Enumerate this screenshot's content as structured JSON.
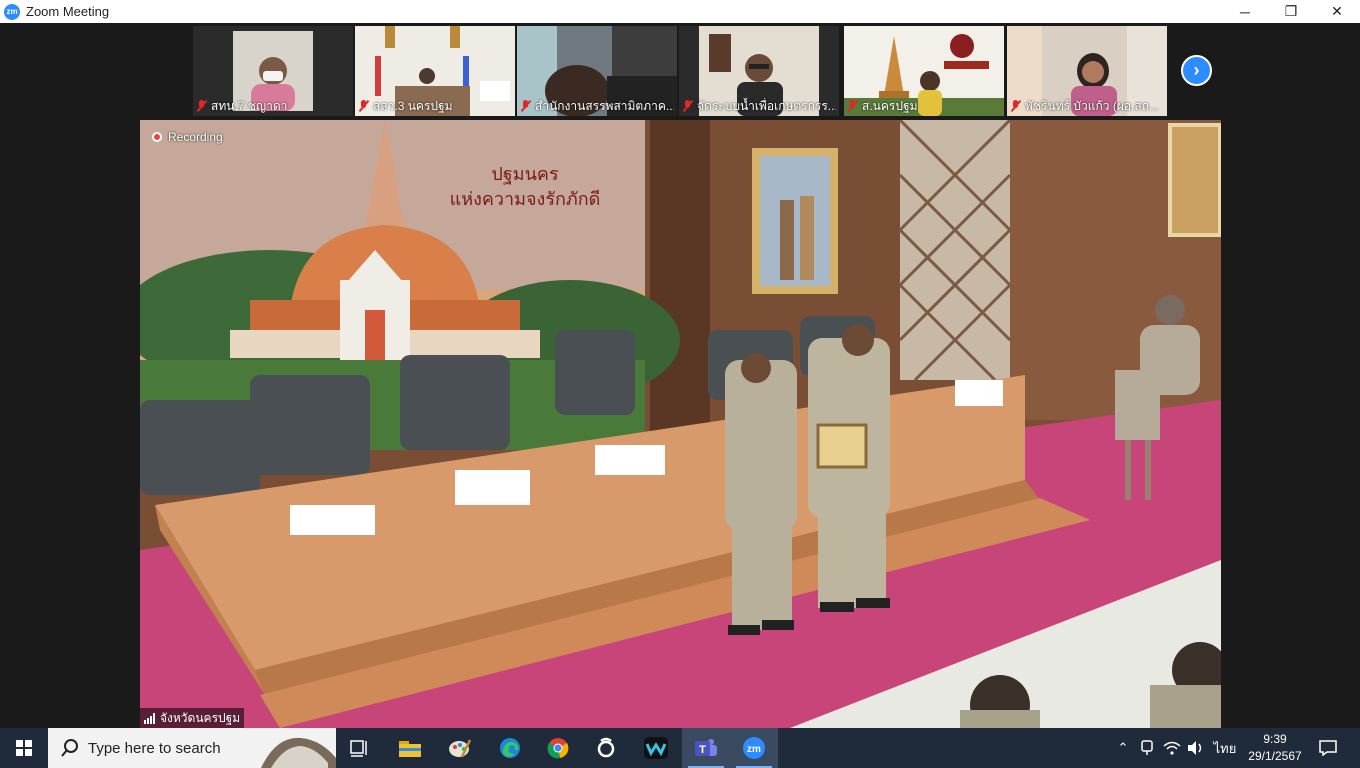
{
  "window": {
    "title": "Zoom Meeting",
    "logo_text": "zm",
    "controls": {
      "minimize": "─",
      "maximize": "❐",
      "close": "✕"
    }
  },
  "participants": [
    {
      "name": "สทน.7 ชญาดา",
      "muted": true
    },
    {
      "name": "สสว.3 นครปฐม",
      "muted": true
    },
    {
      "name": "สำนักงานสรรพสามิตภาค...",
      "muted": true
    },
    {
      "name": "จัดระบบน้ำเพื่อเกษตรกรร...",
      "muted": true
    },
    {
      "name": "ส.นครปฐม",
      "muted": true
    },
    {
      "name": "พัชรินทร์ บัวแก้ว (ผอ.สถ...",
      "muted": true
    }
  ],
  "main_video": {
    "recording_label": "Recording",
    "speaker_name": "จังหวัดนครปฐม",
    "banner_line1": "ปฐมนคร",
    "banner_line2": "แห่งความจงรักภักดี"
  },
  "taskbar": {
    "search_placeholder": "Type here to search",
    "pinned_apps": [
      "task-view",
      "file-explorer",
      "paint",
      "edge",
      "chrome",
      "app-circle",
      "webex",
      "teams",
      "zoom"
    ],
    "active_app": "teams",
    "language": "ไทย",
    "time": "9:39",
    "date": "29/1/2567"
  },
  "colors": {
    "zoom_blue": "#2D8CFF",
    "recording_red": "#e8463a",
    "taskbar": "#1f2a3a",
    "mute_red": "#e02828"
  }
}
